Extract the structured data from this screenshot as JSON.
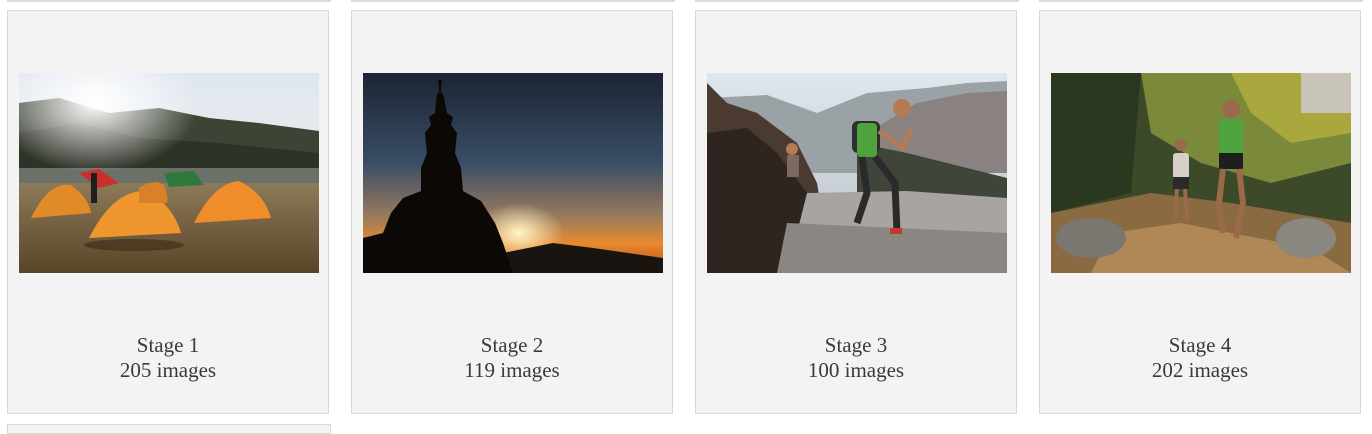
{
  "gallery": {
    "stages": [
      {
        "title": "Stage 1",
        "count": "205 images",
        "image": "camp-tents-photo"
      },
      {
        "title": "Stage 2",
        "count": "119 images",
        "image": "stupa-sunset-photo"
      },
      {
        "title": "Stage 3",
        "count": "100 images",
        "image": "runner-mountain-trail-photo"
      },
      {
        "title": "Stage 4",
        "count": "202 images",
        "image": "runners-forest-trail-photo"
      }
    ]
  }
}
